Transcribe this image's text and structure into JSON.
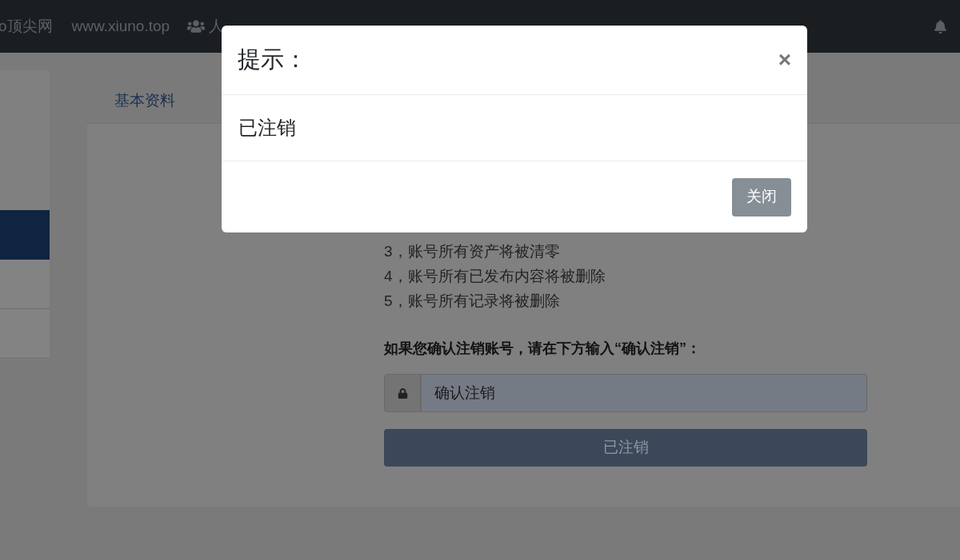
{
  "navbar": {
    "brand": "o顶尖网",
    "site": "www.xiuno.top",
    "people_link": "人"
  },
  "left_card": {
    "items": [
      {
        "selected": true
      },
      {
        "selected": false
      },
      {
        "selected": false
      }
    ]
  },
  "tabs": [
    {
      "label": "基本资料",
      "selected": false
    }
  ],
  "notice_lines": [
    "3，账号所有资产将被清零",
    "4，账号所有已发布内容将被删除",
    "5，账号所有记录将被删除"
  ],
  "confirm_prompt": "如果您确认注销账号，请在下方输入“确认注销”：",
  "confirm_field": {
    "value": "确认注销",
    "disabled": true
  },
  "submit_button": {
    "label": "已注销",
    "disabled": true
  },
  "modal": {
    "title": "提示：",
    "close": "×",
    "body": "已注销",
    "button": "关闭"
  }
}
